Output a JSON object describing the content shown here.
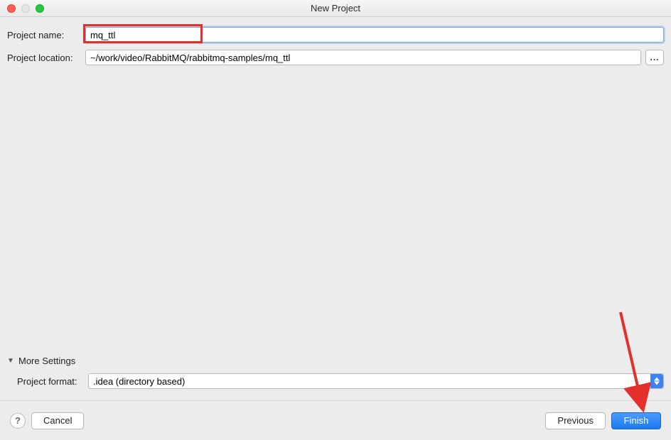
{
  "window": {
    "title": "New Project"
  },
  "form": {
    "project_name_label": "Project name:",
    "project_name_value": "mq_ttl",
    "project_location_label": "Project location:",
    "project_location_value": "~/work/video/RabbitMQ/rabbitmq-samples/mq_ttl",
    "browse_label": "..."
  },
  "more_settings": {
    "header": "More Settings",
    "project_format_label": "Project format:",
    "project_format_value": ".idea (directory based)"
  },
  "footer": {
    "help_label": "?",
    "cancel_label": "Cancel",
    "previous_label": "Previous",
    "finish_label": "Finish"
  }
}
